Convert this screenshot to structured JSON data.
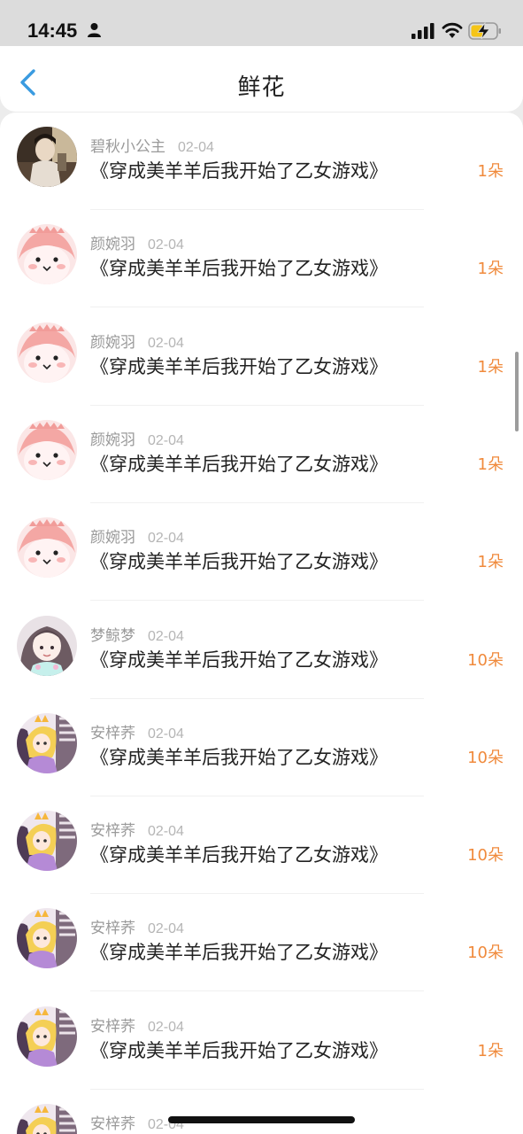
{
  "status_bar": {
    "time": "14:45",
    "icons": [
      "person-icon",
      "cellular-signal-icon",
      "wifi-icon",
      "battery-charging-icon"
    ]
  },
  "nav": {
    "title": "鲜花",
    "back_icon": "chevron-left-icon",
    "accent_color": "#3a9be0"
  },
  "count_color": "#f08a3c",
  "items": [
    {
      "name": "碧秋小公主",
      "date": "02-04",
      "book": "《穿成美羊羊后我开始了乙女游戏》",
      "count": "1朵",
      "avatar": "photo-avatar"
    },
    {
      "name": "颜婉羽",
      "date": "02-04",
      "book": "《穿成美羊羊后我开始了乙女游戏》",
      "count": "1朵",
      "avatar": "pink-creature-avatar"
    },
    {
      "name": "颜婉羽",
      "date": "02-04",
      "book": "《穿成美羊羊后我开始了乙女游戏》",
      "count": "1朵",
      "avatar": "pink-creature-avatar"
    },
    {
      "name": "颜婉羽",
      "date": "02-04",
      "book": "《穿成美羊羊后我开始了乙女游戏》",
      "count": "1朵",
      "avatar": "pink-creature-avatar"
    },
    {
      "name": "颜婉羽",
      "date": "02-04",
      "book": "《穿成美羊羊后我开始了乙女游戏》",
      "count": "1朵",
      "avatar": "pink-creature-avatar"
    },
    {
      "name": "梦鲸梦",
      "date": "02-04",
      "book": "《穿成美羊羊后我开始了乙女游戏》",
      "count": "10朵",
      "avatar": "anime-girl-avatar"
    },
    {
      "name": "安梓荞",
      "date": "02-04",
      "book": "《穿成美羊羊后我开始了乙女游戏》",
      "count": "10朵",
      "avatar": "blonde-princess-avatar"
    },
    {
      "name": "安梓荞",
      "date": "02-04",
      "book": "《穿成美羊羊后我开始了乙女游戏》",
      "count": "10朵",
      "avatar": "blonde-princess-avatar"
    },
    {
      "name": "安梓荞",
      "date": "02-04",
      "book": "《穿成美羊羊后我开始了乙女游戏》",
      "count": "10朵",
      "avatar": "blonde-princess-avatar"
    },
    {
      "name": "安梓荞",
      "date": "02-04",
      "book": "《穿成美羊羊后我开始了乙女游戏》",
      "count": "1朵",
      "avatar": "blonde-princess-avatar"
    },
    {
      "name": "安梓荞",
      "date": "02-04",
      "book": "",
      "count": "",
      "avatar": "blonde-princess-avatar"
    }
  ]
}
